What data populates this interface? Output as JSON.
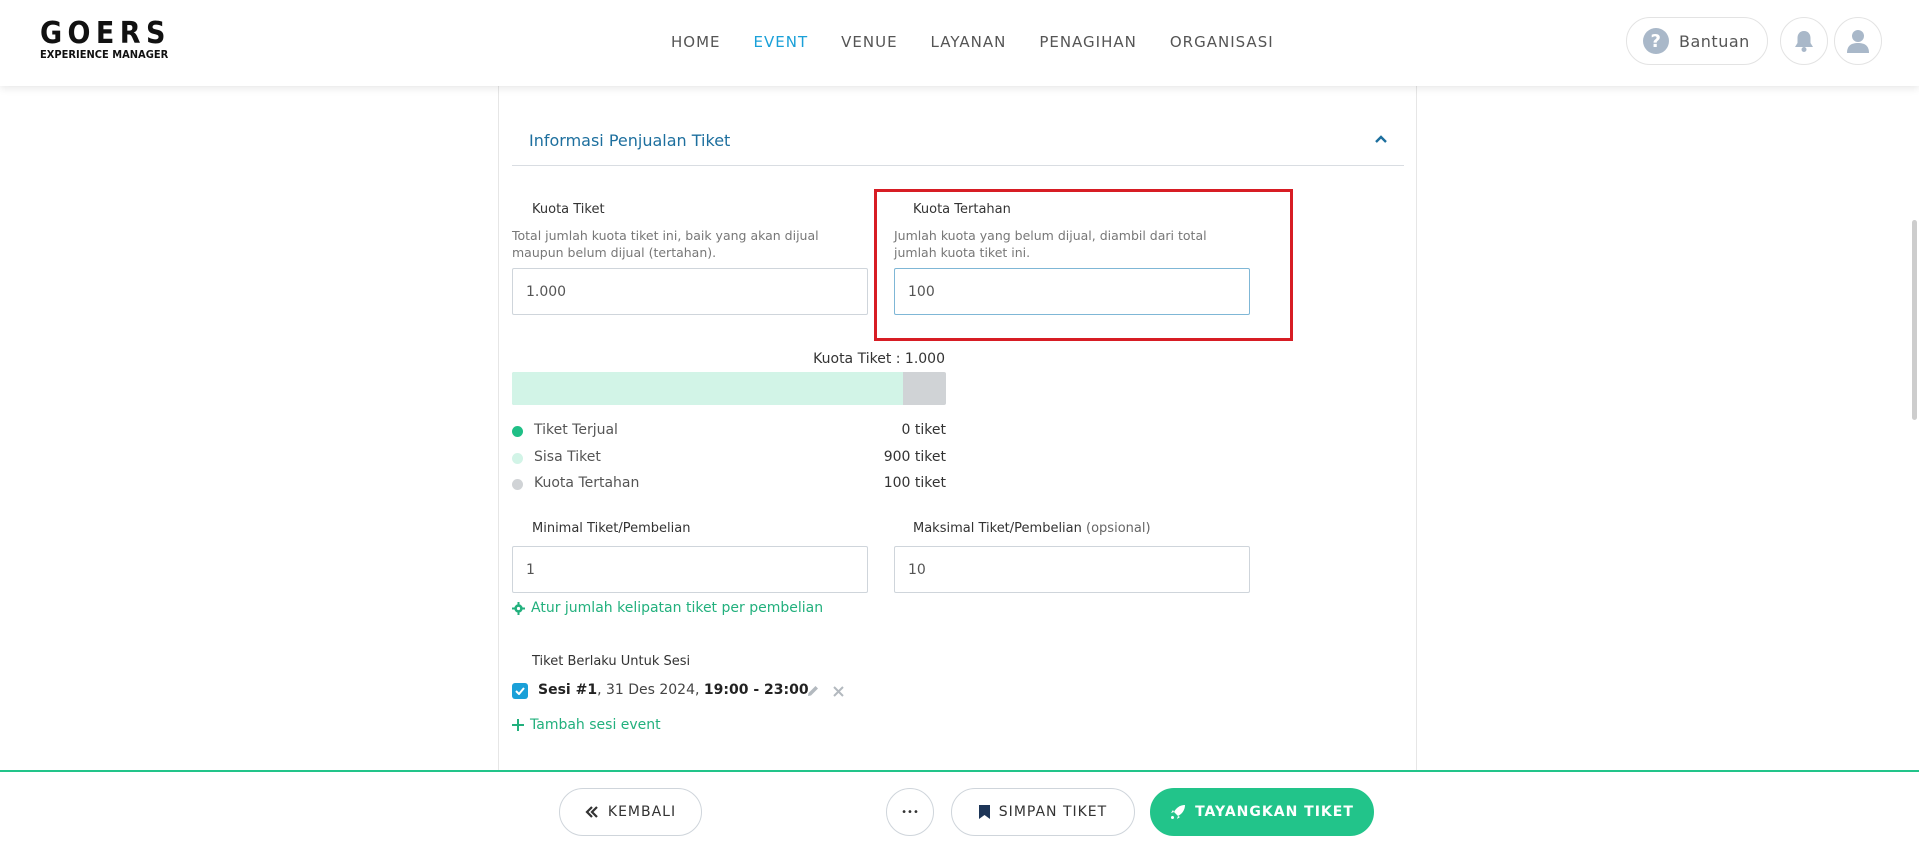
{
  "header": {
    "logo_main": "GOERS",
    "logo_sub": "EXPERIENCE MANAGER",
    "nav": [
      "HOME",
      "EVENT",
      "VENUE",
      "LAYANAN",
      "PENAGIHAN",
      "ORGANISASI"
    ],
    "active_nav": "EVENT",
    "help_label": "Bantuan"
  },
  "section": {
    "title": "Informasi Penjualan Tiket"
  },
  "quota": {
    "label": "Kuota Tiket",
    "help": "Total jumlah kuota tiket ini, baik yang akan dijual maupun belum dijual (tertahan).",
    "value": "1.000"
  },
  "held_quota": {
    "label": "Kuota Tertahan",
    "help": "Jumlah kuota yang belum dijual, diambil dari total jumlah kuota tiket ini.",
    "value": "100"
  },
  "summary": {
    "total_label": "Kuota Tiket : 1.000",
    "available_fraction": 0.9,
    "legend": [
      {
        "name": "Tiket Terjual",
        "value": "0 tiket",
        "color": "#1fbf86"
      },
      {
        "name": "Sisa Tiket",
        "value": "900 tiket",
        "color": "#d2f4e7"
      },
      {
        "name": "Kuota Tertahan",
        "value": "100 tiket",
        "color": "#d0d3d6"
      }
    ]
  },
  "min_per_purchase": {
    "label": "Minimal Tiket/Pembelian",
    "value": "1"
  },
  "max_per_purchase": {
    "label": "Maksimal Tiket/Pembelian",
    "optional": "(opsional)",
    "value": "10"
  },
  "multiple_link": "Atur jumlah kelipatan tiket per pembelian",
  "sessions": {
    "label": "Tiket Berlaku Untuk Sesi",
    "items": [
      {
        "name": "Sesi #1",
        "date": ", 31 Des 2024, ",
        "time": "19:00 - 23:00"
      }
    ],
    "add_label": "Tambah sesi event"
  },
  "footer": {
    "back": "KEMBALI",
    "more": "•••",
    "save": "SIMPAN TIKET",
    "publish": "TAYANGKAN TIKET"
  },
  "colors": {
    "accent": "#1aa0d8",
    "green": "#22c48a",
    "highlight": "#d71d24"
  }
}
